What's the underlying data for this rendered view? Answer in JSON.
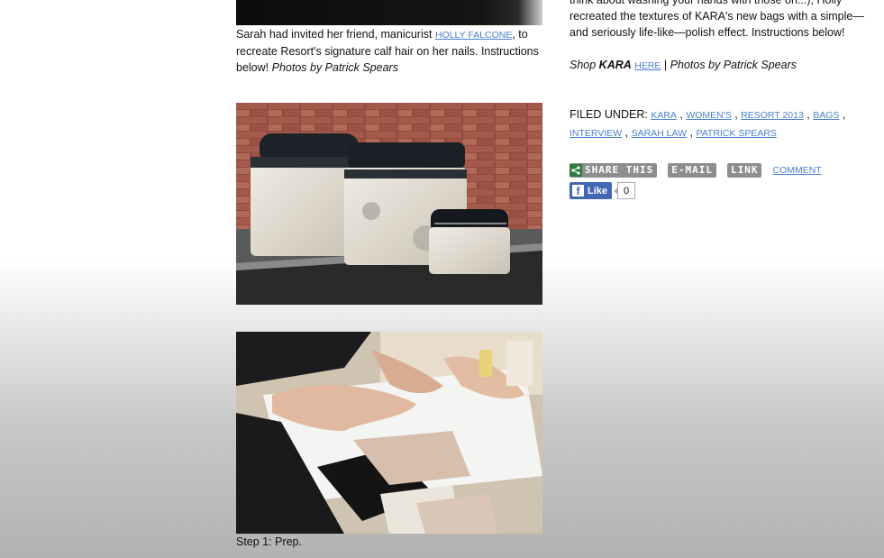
{
  "left_column": {
    "top_caption": {
      "before_link": "Sarah had invited her friend, manicurist ",
      "link": "HOLLY FALCONE",
      "after_link": ", to recreate Resort's signature calf hair on her nails. Instructions below! ",
      "credit": "Photos by Patrick Spears"
    },
    "step_caption": "Step 1: Prep."
  },
  "right_column": {
    "intro_line1": "think about washing your hands with those on...), Holly",
    "intro_rest": "recreated the textures of KARA's new bags with a simple—and seriously life-like—polish effect. Instructions below!",
    "shop_prefix": "Shop ",
    "shop_brand": "KARA",
    "shop_link": "HERE",
    "shop_sep": " | ",
    "shop_credit": "Photos by Patrick Spears",
    "filed_under_label": "FILED UNDER:",
    "tags": [
      "KARA",
      "WOMEN'S",
      "RESORT 2013",
      "BAGS",
      "INTERVIEW",
      "SARAH LAW",
      "PATRICK SPEARS"
    ],
    "share": {
      "share_this": "SHARE THIS",
      "email": "E-MAIL",
      "link": "LINK",
      "comment": "COMMENT"
    },
    "facebook": {
      "like_label": "Like",
      "count": "0"
    }
  },
  "colors": {
    "link": "#4a7fd0",
    "share_green": "#2f7d3a",
    "button_gray": "#8e8e8e",
    "facebook_blue": "#4267b2"
  }
}
